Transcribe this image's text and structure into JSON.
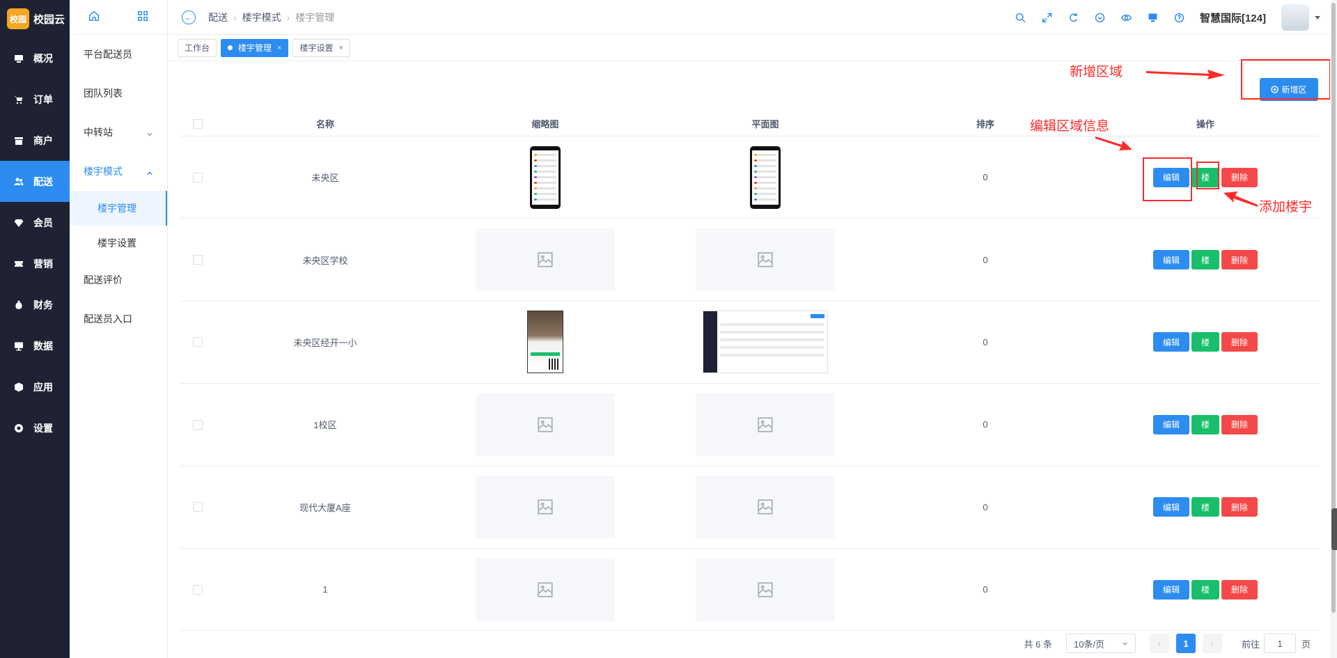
{
  "app": {
    "logo_mark": "校园",
    "logo_text": "校园云"
  },
  "nav": [
    {
      "label": "概况",
      "icon": "monitor-icon"
    },
    {
      "label": "订单",
      "icon": "shopping-cart-icon"
    },
    {
      "label": "商户",
      "icon": "store-icon"
    },
    {
      "label": "配送",
      "icon": "user-group-icon",
      "active": true
    },
    {
      "label": "会员",
      "icon": "diamond-icon"
    },
    {
      "label": "营销",
      "icon": "ticket-icon"
    },
    {
      "label": "财务",
      "icon": "money-bag-icon"
    },
    {
      "label": "数据",
      "icon": "chart-screen-icon"
    },
    {
      "label": "应用",
      "icon": "cube-icon"
    },
    {
      "label": "设置",
      "icon": "settings-icon"
    }
  ],
  "subnav": {
    "items": [
      {
        "label": "平台配送员"
      },
      {
        "label": "团队列表"
      },
      {
        "label": "中转站",
        "has_children": true
      },
      {
        "label": "楼宇模式",
        "open": true
      },
      {
        "label": "楼宇管理",
        "child": true,
        "active": true
      },
      {
        "label": "楼宇设置",
        "child": true
      },
      {
        "label": "配送评价"
      },
      {
        "label": "配送员入口"
      }
    ]
  },
  "breadcrumb": [
    "配送",
    "楼宇模式",
    "楼宇管理"
  ],
  "header": {
    "org_name": "智慧国际[124]"
  },
  "tabs": [
    {
      "label": "工作台"
    },
    {
      "label": "楼宇管理",
      "active": true
    },
    {
      "label": "楼宇设置"
    }
  ],
  "toolbar": {
    "add_label": "新增区"
  },
  "table": {
    "columns": [
      "名称",
      "缩略图",
      "平面图",
      "排序",
      "操作"
    ],
    "rows": [
      {
        "name": "未央区",
        "thumb": "phone",
        "plan": "phone",
        "sort": "0"
      },
      {
        "name": "未央区学校",
        "thumb": "placeholder",
        "plan": "placeholder",
        "sort": "0"
      },
      {
        "name": "未央区经开一小",
        "thumb": "photo",
        "plan": "screenshot",
        "sort": "0"
      },
      {
        "name": "1校区",
        "thumb": "placeholder",
        "plan": "placeholder",
        "sort": "0"
      },
      {
        "name": "现代大厦A座",
        "thumb": "placeholder",
        "plan": "placeholder",
        "sort": "0"
      },
      {
        "name": "1",
        "thumb": "placeholder",
        "plan": "placeholder",
        "sort": "0"
      }
    ],
    "ops": {
      "edit": "编辑",
      "building": "楼",
      "delete": "删除"
    }
  },
  "pagination": {
    "total_text": "共 6 条",
    "page_size": "10条/页",
    "current": "1",
    "goto_prefix": "前往",
    "goto_value": "1",
    "goto_suffix": "页"
  },
  "annotations": {
    "add_region": "新增区域",
    "edit_region": "编辑区域信息",
    "add_building": "添加楼宇"
  },
  "colors": {
    "primary": "#2d8cf0",
    "success": "#19be6b",
    "danger": "#f54848",
    "annotation": "#ff2a2a",
    "nav_bg": "#1f2233"
  }
}
